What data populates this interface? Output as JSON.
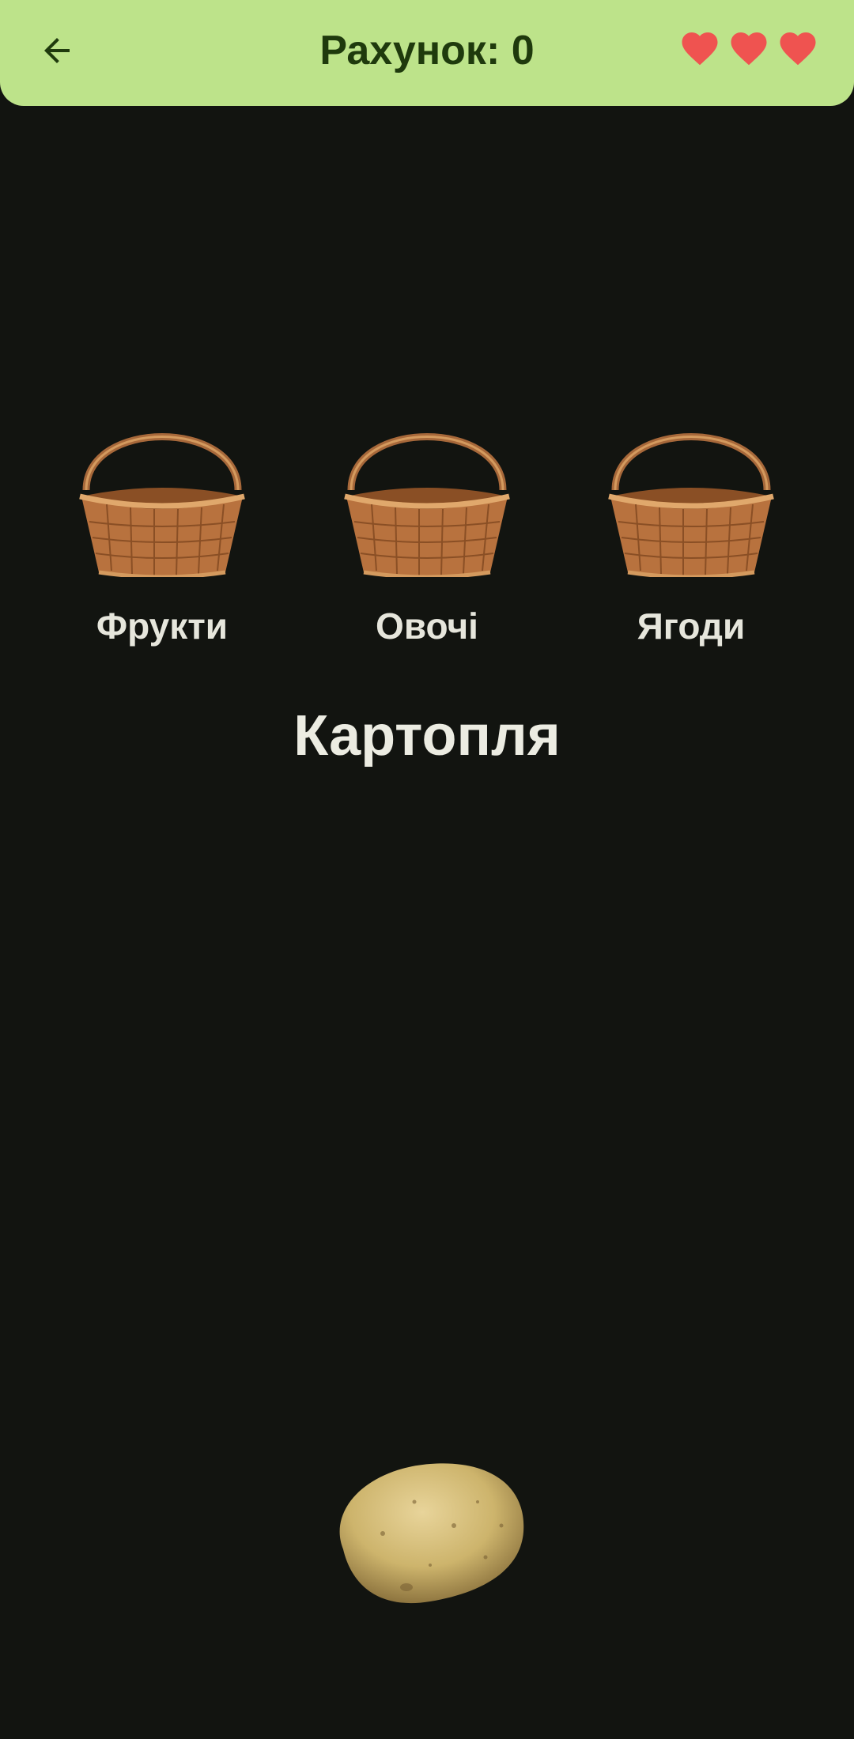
{
  "header": {
    "back_icon": "arrow-left-icon",
    "score_text": "Рахунок: 0",
    "lives": 3,
    "life_icon": "heart-icon",
    "background_color": "#bde38a",
    "life_color": "#ef5350"
  },
  "baskets": [
    {
      "label": "Фрукти",
      "icon": "basket-icon"
    },
    {
      "label": "Овочі",
      "icon": "basket-icon"
    },
    {
      "label": "Ягоди",
      "icon": "basket-icon"
    }
  ],
  "current_item": {
    "name": "Картопля",
    "icon": "potato-icon"
  },
  "colors": {
    "background": "#121410",
    "text": "#e6e6dc",
    "header_text": "#1f3a0d"
  }
}
